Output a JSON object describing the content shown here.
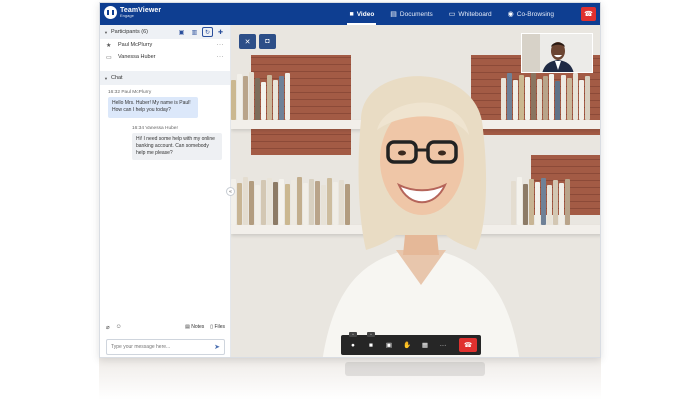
{
  "app": {
    "brand_name": "TeamViewer",
    "brand_sub": "Engage"
  },
  "nav": {
    "items": [
      {
        "label": "Video",
        "icon": "video-camera-icon",
        "active": true
      },
      {
        "label": "Documents",
        "icon": "document-icon",
        "active": false
      },
      {
        "label": "Whiteboard",
        "icon": "whiteboard-icon",
        "active": false
      },
      {
        "label": "Co-Browsing",
        "icon": "eye-icon",
        "active": false
      }
    ],
    "end_call_icon": "phone-hangup-icon"
  },
  "participants": {
    "header": "Participants (6)",
    "list": [
      {
        "name": "Paul McPlurry",
        "icon": "star-icon"
      },
      {
        "name": "Vanessa Huber",
        "icon": "monitor-icon"
      }
    ]
  },
  "chat": {
    "header": "Chat",
    "messages": [
      {
        "time": "16:32",
        "author": "Paul McPlurry",
        "text": "Hello Mrs. Huber! My name is Paul! How can I help you today?"
      },
      {
        "time": "16:34",
        "author": "Vanessa Huber",
        "text": "Hi! I need some help with my online banking account. Can somebody help me please?"
      }
    ],
    "notes_label": "Notes",
    "files_label": "Files",
    "input_placeholder": "Type your message here..."
  },
  "colors": {
    "brand": "#0e3e91",
    "end_call": "#e0312f",
    "outgoing_bubble": "#dce8fa"
  }
}
